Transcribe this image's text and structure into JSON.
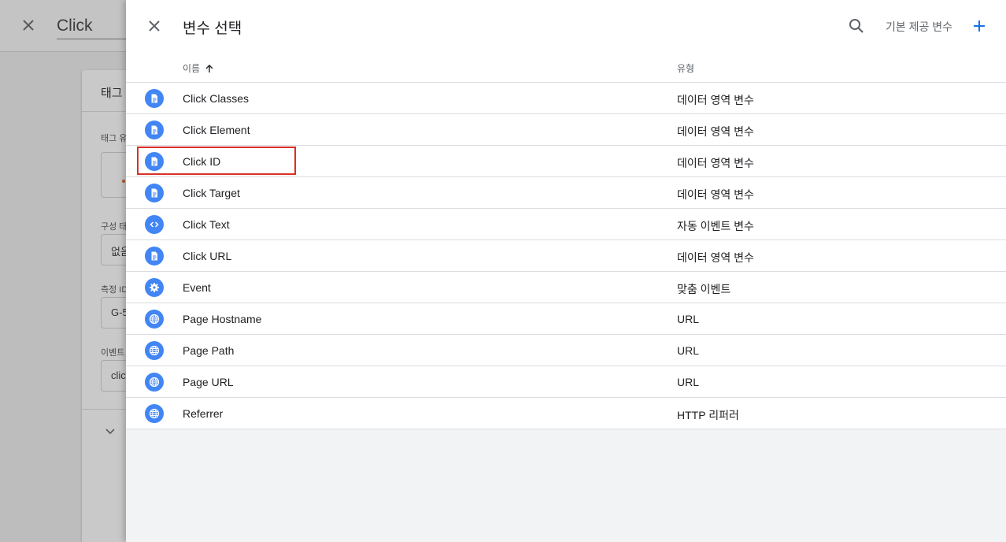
{
  "background": {
    "title": "Click",
    "card_title": "태그",
    "labels": [
      "태그 유",
      "구성 태",
      "측정 ID",
      "이벤트"
    ],
    "values": [
      "없음",
      "G-5",
      "clic"
    ]
  },
  "panel": {
    "title": "변수 선택",
    "builtin_label": "기본 제공 변수",
    "columns": {
      "name": "이름",
      "type": "유형"
    }
  },
  "rows": [
    {
      "name": "Click Classes",
      "type": "데이터 영역 변수",
      "icon": "document-icon"
    },
    {
      "name": "Click Element",
      "type": "데이터 영역 변수",
      "icon": "document-icon"
    },
    {
      "name": "Click ID",
      "type": "데이터 영역 변수",
      "icon": "document-icon"
    },
    {
      "name": "Click Target",
      "type": "데이터 영역 변수",
      "icon": "document-icon"
    },
    {
      "name": "Click Text",
      "type": "자동 이벤트 변수",
      "icon": "code-icon"
    },
    {
      "name": "Click URL",
      "type": "데이터 영역 변수",
      "icon": "document-icon"
    },
    {
      "name": "Event",
      "type": "맞춤 이벤트",
      "icon": "gear-icon"
    },
    {
      "name": "Page Hostname",
      "type": "URL",
      "icon": "globe-icon"
    },
    {
      "name": "Page Path",
      "type": "URL",
      "icon": "globe-icon"
    },
    {
      "name": "Page URL",
      "type": "URL",
      "icon": "globe-icon"
    },
    {
      "name": "Referrer",
      "type": "HTTP 리퍼러",
      "icon": "globe-icon"
    }
  ],
  "colors": {
    "accent": "#4285f4",
    "highlight": "#d93025",
    "add": "#1a73e8"
  }
}
